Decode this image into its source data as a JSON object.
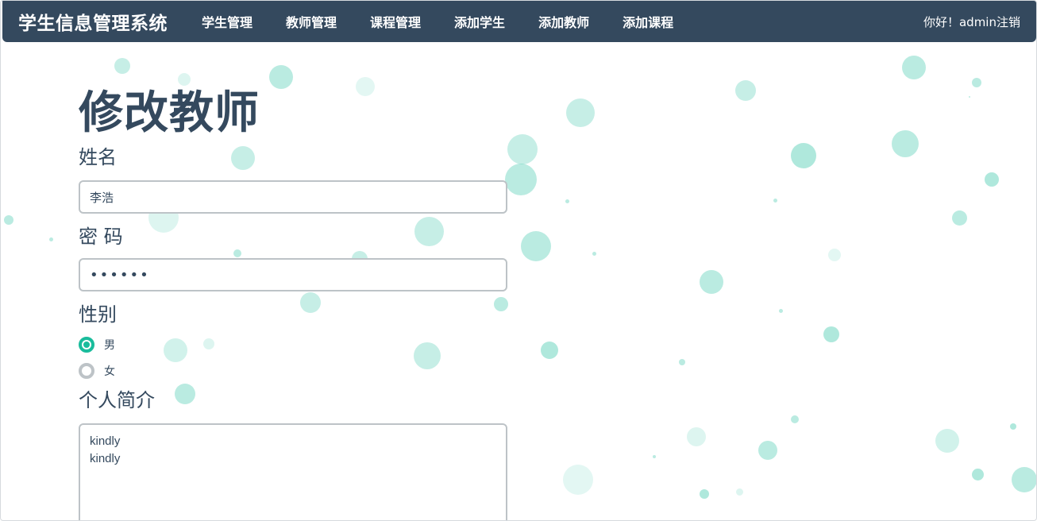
{
  "nav": {
    "brand": "学生信息管理系统",
    "links": [
      "学生管理",
      "教师管理",
      "课程管理",
      "添加学生",
      "添加教师",
      "添加课程"
    ],
    "greeting": "你好！admin",
    "logout": "注销"
  },
  "form": {
    "title": "修改教师",
    "name_label": "姓名",
    "name_value": "李浩",
    "password_label": "密 码",
    "password_value": "••••••",
    "gender_label": "性别",
    "gender_options": [
      "男",
      "女"
    ],
    "gender_selected": "男",
    "bio_label": "个人简介",
    "bio_value": "kindly\nkindly"
  },
  "colors": {
    "navbar": "#34495e",
    "accent": "#1abc9c",
    "text": "#34495e",
    "border": "#bdc3c7"
  }
}
